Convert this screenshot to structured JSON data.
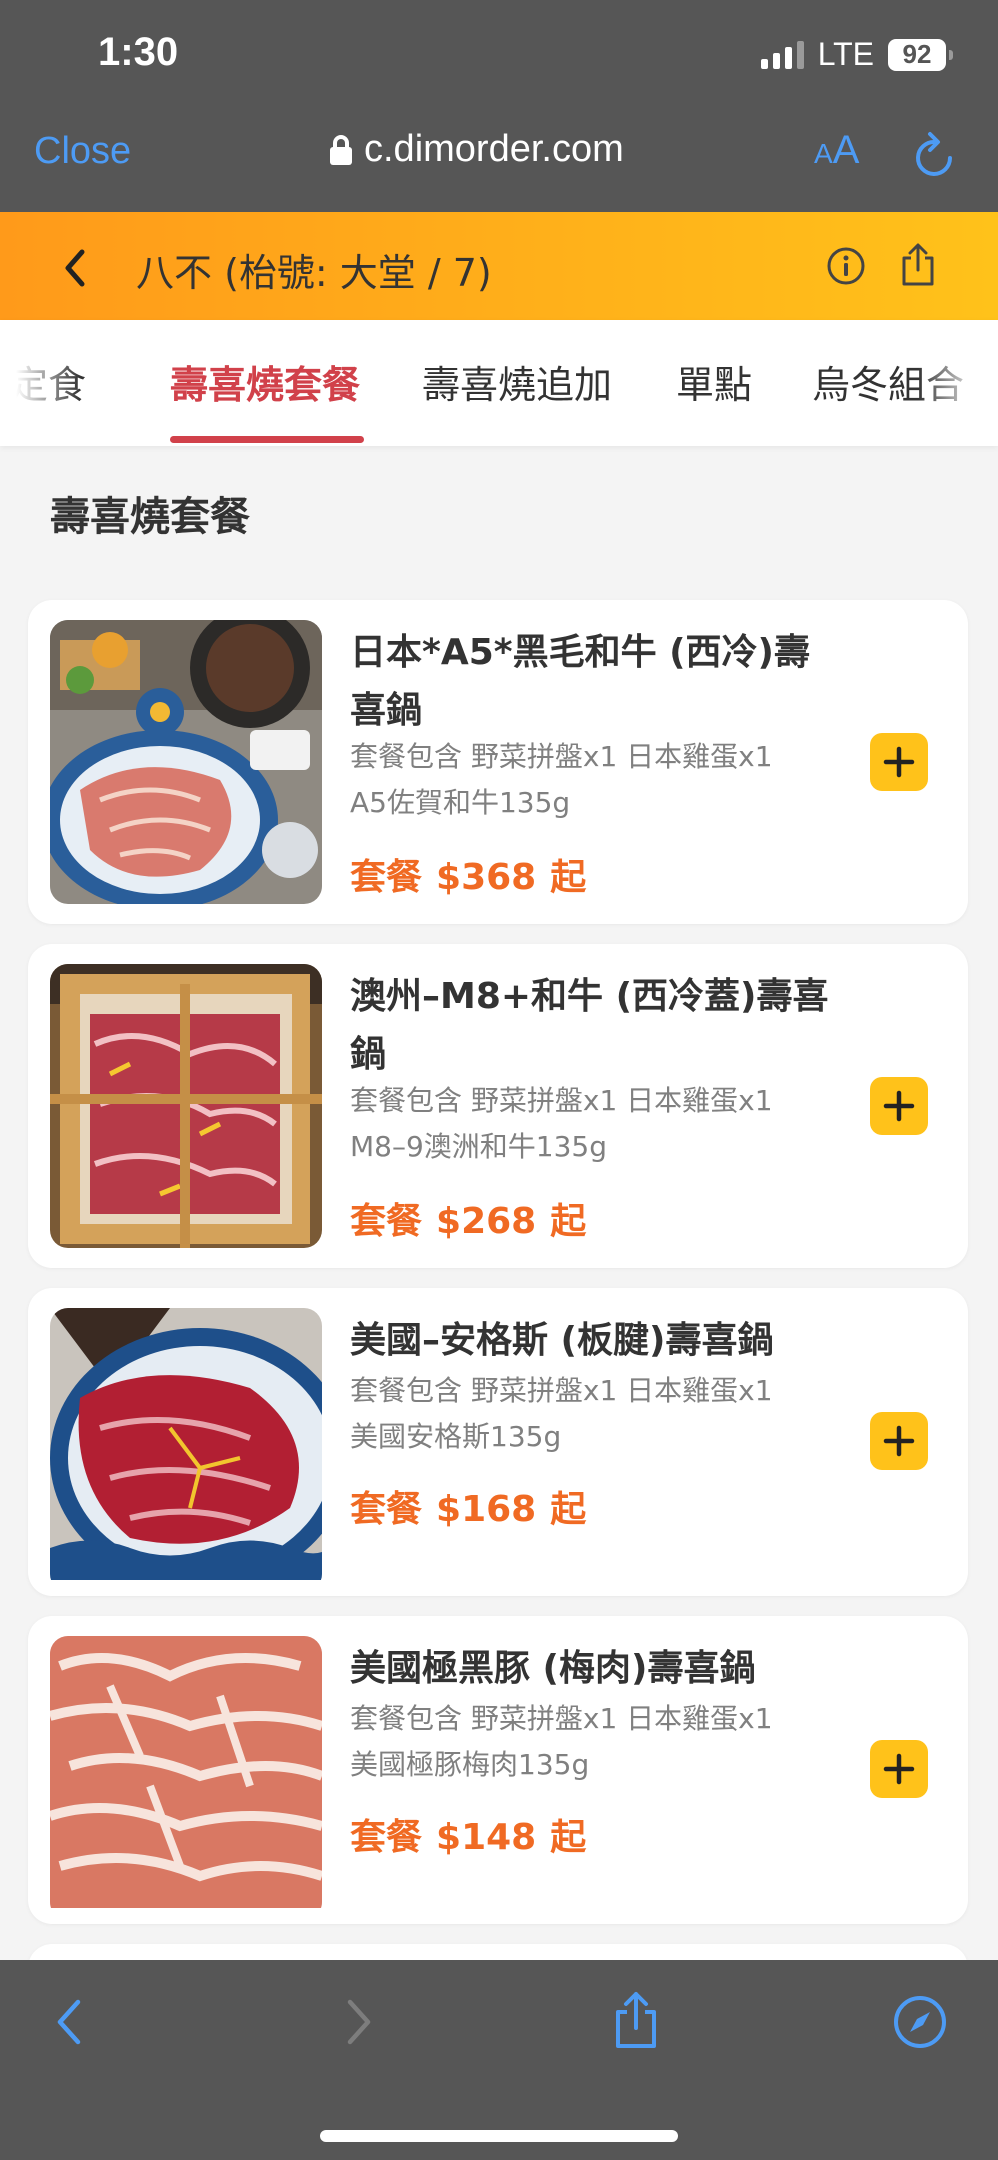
{
  "status_bar": {
    "time": "1:30",
    "network": "LTE",
    "battery": "92"
  },
  "browser": {
    "close_label": "Close",
    "url": "c.dimorder.com",
    "text_size_label_small": "A",
    "text_size_label_large": "A"
  },
  "header": {
    "title": "八不 (枱號: 大堂 / 7)"
  },
  "tabs": [
    {
      "label": "定食"
    },
    {
      "label": "壽喜燒套餐"
    },
    {
      "label": "壽喜燒追加"
    },
    {
      "label": "單點"
    },
    {
      "label": "烏冬組合"
    }
  ],
  "section": {
    "title": "壽喜燒套餐"
  },
  "items": [
    {
      "name": "日本*A5*黑毛和牛 (西冷)壽喜鍋",
      "desc_line1": "套餐包含 野菜拼盤x1 日本雞蛋x1",
      "desc_line2": "A5佐賀和牛135g",
      "price_prefix": "套餐",
      "price": "$368",
      "price_suffix": "起"
    },
    {
      "name": "澳州–M8+和牛 (西冷蓋)壽喜鍋",
      "desc_line1": "套餐包含 野菜拼盤x1 日本雞蛋x1",
      "desc_line2": "M8–9澳洲和牛135g",
      "price_prefix": "套餐",
      "price": "$268",
      "price_suffix": "起"
    },
    {
      "name": "美國–安格斯 (板腱)壽喜鍋",
      "desc_line1": "套餐包含 野菜拼盤x1 日本雞蛋x1",
      "desc_line2": "美國安格斯135g",
      "price_prefix": "套餐",
      "price": "$168",
      "price_suffix": "起"
    },
    {
      "name": "美國極黑豚 (梅肉)壽喜鍋",
      "desc_line1": "套餐包含 野菜拼盤x1 日本雞蛋x1",
      "desc_line2": "美國極豚梅肉135g",
      "price_prefix": "套餐",
      "price": "$148",
      "price_suffix": "起"
    }
  ],
  "colors": {
    "accent_red": "#d1414a",
    "price_orange": "#f06a23",
    "add_button": "#ffc21a",
    "link_blue": "#4d9bf4"
  },
  "icons": [
    "back-chevron-icon",
    "info-icon",
    "share-icon",
    "reload-icon",
    "plus-icon",
    "compass-icon",
    "forward-chevron-icon"
  ]
}
